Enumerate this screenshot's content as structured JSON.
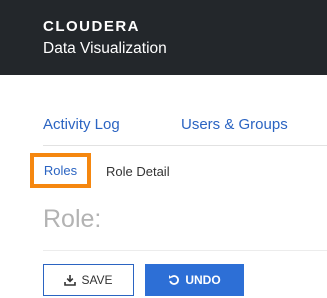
{
  "header": {
    "brand": "CLOUDERA",
    "product": "Data Visualization"
  },
  "nav": {
    "activity_log": "Activity Log",
    "users_groups": "Users & Groups"
  },
  "breadcrumb": {
    "roles": "Roles",
    "role_detail": "Role Detail"
  },
  "page": {
    "title": "Role:"
  },
  "buttons": {
    "save": "SAVE",
    "undo": "UNDO"
  },
  "icons": {
    "save": "download-icon",
    "undo": "undo-icon"
  },
  "colors": {
    "header_bg": "#23272b",
    "link": "#2b64c2",
    "highlight": "#f5870f",
    "primary": "#2d6fd6"
  }
}
